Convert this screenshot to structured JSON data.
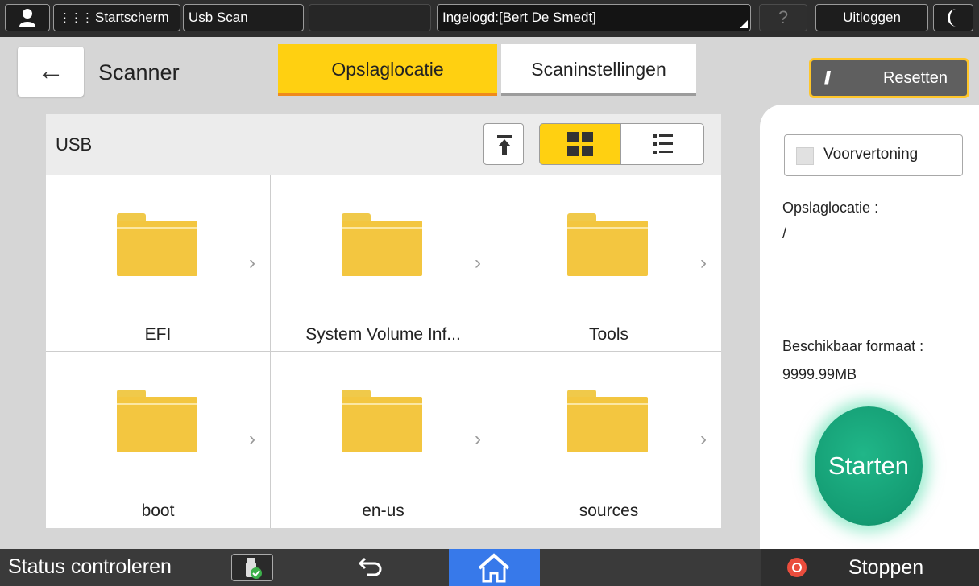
{
  "topbar": {
    "home_label": "Startscherm",
    "app_label": "Usb Scan",
    "login_label": "Ingelogd:[Bert De Smedt]",
    "help_label": "?",
    "logout_label": "Uitloggen"
  },
  "header": {
    "title": "Scanner",
    "tabs": [
      {
        "label": "Opslaglocatie",
        "active": true
      },
      {
        "label": "Scaninstellingen",
        "active": false
      }
    ],
    "reset_label": "Resetten"
  },
  "browser": {
    "location": "USB",
    "view_mode": "grid",
    "folders": [
      {
        "name": "EFI"
      },
      {
        "name": "System Volume Inf..."
      },
      {
        "name": "Tools"
      },
      {
        "name": "boot"
      },
      {
        "name": "en-us"
      },
      {
        "name": "sources"
      }
    ]
  },
  "panel": {
    "preview_label": "Voorvertoning",
    "preview_checked": false,
    "storage_label": "Opslaglocatie :",
    "storage_value": "/",
    "available_label": "Beschikbaar formaat :",
    "available_value": "9999.99MB",
    "start_label": "Starten"
  },
  "bottombar": {
    "status_label": "Status controleren",
    "stop_label": "Stoppen"
  },
  "colors": {
    "accent_yellow": "#ffd011",
    "tab_underline": "#ef8a1c",
    "start_green": "#149c73",
    "home_blue": "#3779ea",
    "stop_red": "#ea4d3d"
  }
}
